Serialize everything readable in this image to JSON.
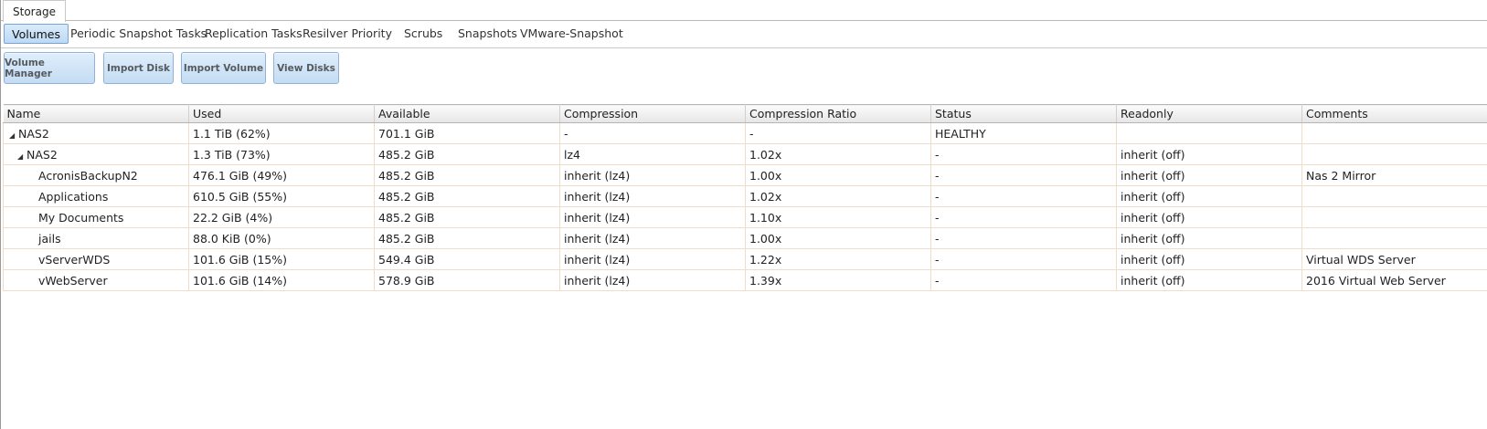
{
  "top_tab": {
    "label": "Storage"
  },
  "sub_tabs": [
    {
      "label": "Volumes",
      "active": true
    },
    {
      "label": "Periodic Snapshot Tasks"
    },
    {
      "label": "Replication Tasks"
    },
    {
      "label": "Resilver Priority"
    },
    {
      "label": "Scrubs"
    },
    {
      "label": "Snapshots"
    },
    {
      "label": "VMware-Snapshot"
    }
  ],
  "toolbar": {
    "volume_manager": "Volume Manager",
    "import_disk": "Import Disk",
    "import_volume": "Import Volume",
    "view_disks": "View Disks"
  },
  "table": {
    "columns": [
      "Name",
      "Used",
      "Available",
      "Compression",
      "Compression Ratio",
      "Status",
      "Readonly",
      "Comments"
    ],
    "rows": [
      {
        "name": "NAS2",
        "used": "1.1 TiB (62%)",
        "available": "701.1 GiB",
        "compression": "-",
        "ratio": "-",
        "status": "HEALTHY",
        "readonly": "",
        "comments": ""
      },
      {
        "name": "NAS2",
        "used": "1.3 TiB (73%)",
        "available": "485.2 GiB",
        "compression": "lz4",
        "ratio": "1.02x",
        "status": "-",
        "readonly": "inherit (off)",
        "comments": ""
      },
      {
        "name": "AcronisBackupN2",
        "used": "476.1 GiB (49%)",
        "available": "485.2 GiB",
        "compression": "inherit (lz4)",
        "ratio": "1.00x",
        "status": "-",
        "readonly": "inherit (off)",
        "comments": "Nas 2 Mirror"
      },
      {
        "name": "Applications",
        "used": "610.5 GiB (55%)",
        "available": "485.2 GiB",
        "compression": "inherit (lz4)",
        "ratio": "1.02x",
        "status": "-",
        "readonly": "inherit (off)",
        "comments": ""
      },
      {
        "name": "My Documents",
        "used": "22.2 GiB (4%)",
        "available": "485.2 GiB",
        "compression": "inherit (lz4)",
        "ratio": "1.10x",
        "status": "-",
        "readonly": "inherit (off)",
        "comments": ""
      },
      {
        "name": "jails",
        "used": "88.0 KiB (0%)",
        "available": "485.2 GiB",
        "compression": "inherit (lz4)",
        "ratio": "1.00x",
        "status": "-",
        "readonly": "inherit (off)",
        "comments": ""
      },
      {
        "name": "vServerWDS",
        "used": "101.6 GiB (15%)",
        "available": "549.4 GiB",
        "compression": "inherit (lz4)",
        "ratio": "1.22x",
        "status": "-",
        "readonly": "inherit (off)",
        "comments": "Virtual WDS Server"
      },
      {
        "name": "vWebServer",
        "used": "101.6 GiB (14%)",
        "available": "578.9 GiB",
        "compression": "inherit (lz4)",
        "ratio": "1.39x",
        "status": "-",
        "readonly": "inherit (off)",
        "comments": "2016 Virtual Web Server"
      }
    ]
  }
}
